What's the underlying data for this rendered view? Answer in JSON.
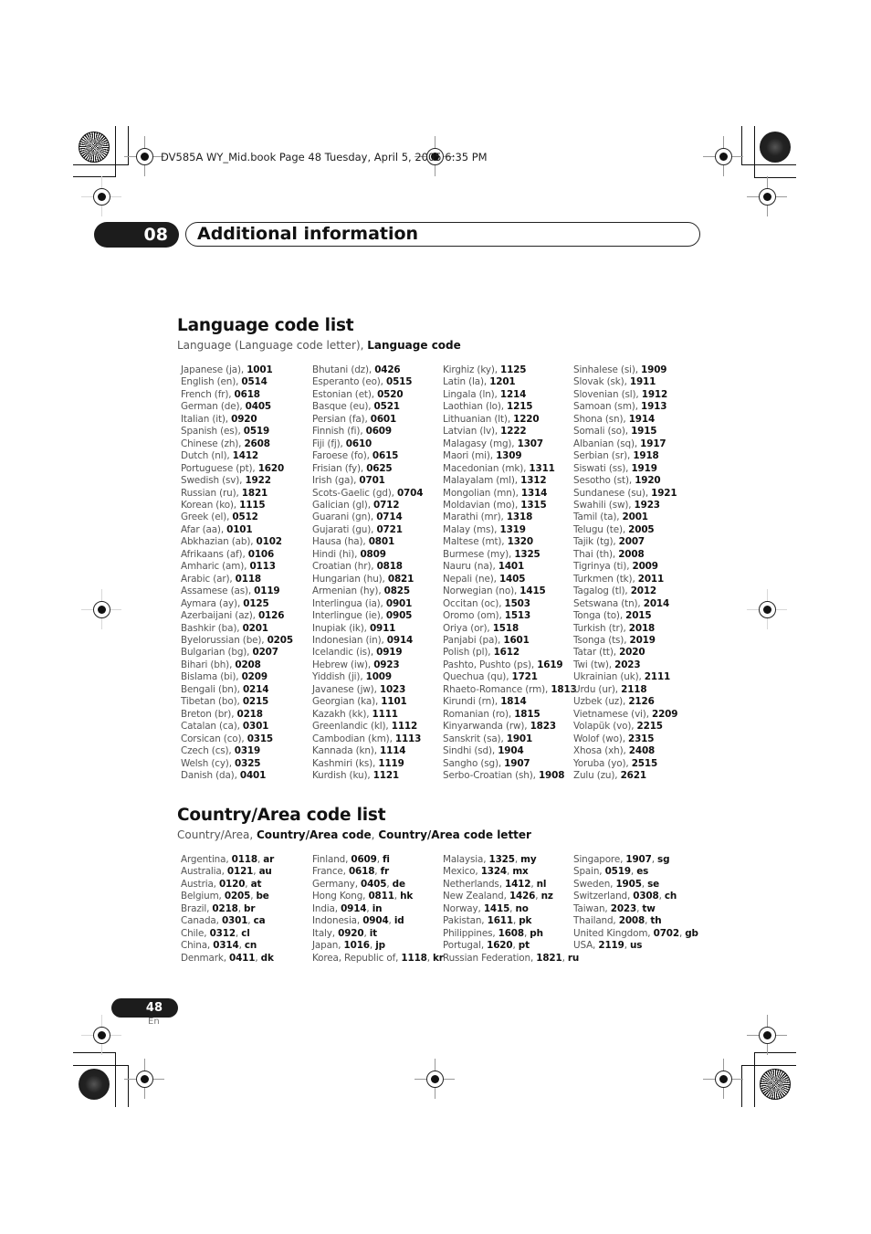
{
  "print_header": {
    "book_line": "DV585A WY_Mid.book  Page 48  Tuesday, April 5, 2005  6:35 PM"
  },
  "chapter": {
    "number": "08",
    "title": "Additional information"
  },
  "language_section": {
    "title": "Language code list",
    "subtitle_plain": "Language (Language code letter), ",
    "subtitle_bold": "Language code",
    "columns": [
      [
        {
          "name": "Japanese (ja), ",
          "code": "1001"
        },
        {
          "name": "English (en), ",
          "code": "0514"
        },
        {
          "name": "French (fr), ",
          "code": "0618"
        },
        {
          "name": "German (de), ",
          "code": "0405"
        },
        {
          "name": "Italian (it), ",
          "code": "0920"
        },
        {
          "name": "Spanish (es), ",
          "code": "0519"
        },
        {
          "name": "Chinese (zh), ",
          "code": "2608"
        },
        {
          "name": "Dutch (nl), ",
          "code": "1412"
        },
        {
          "name": "Portuguese (pt), ",
          "code": "1620"
        },
        {
          "name": "Swedish (sv), ",
          "code": "1922"
        },
        {
          "name": "Russian (ru), ",
          "code": "1821"
        },
        {
          "name": "Korean (ko), ",
          "code": "1115"
        },
        {
          "name": "Greek (el), ",
          "code": "0512"
        },
        {
          "name": "Afar (aa), ",
          "code": "0101"
        },
        {
          "name": "Abkhazian (ab), ",
          "code": "0102"
        },
        {
          "name": "Afrikaans (af), ",
          "code": "0106"
        },
        {
          "name": "Amharic (am), ",
          "code": "0113"
        },
        {
          "name": "Arabic (ar), ",
          "code": "0118"
        },
        {
          "name": "Assamese (as), ",
          "code": "0119"
        },
        {
          "name": "Aymara (ay), ",
          "code": "0125"
        },
        {
          "name": "Azerbaijani (az), ",
          "code": "0126"
        },
        {
          "name": "Bashkir (ba), ",
          "code": "0201"
        },
        {
          "name": "Byelorussian (be), ",
          "code": "0205"
        },
        {
          "name": "Bulgarian (bg), ",
          "code": "0207"
        },
        {
          "name": "Bihari (bh), ",
          "code": "0208"
        },
        {
          "name": "Bislama (bi), ",
          "code": "0209"
        },
        {
          "name": "Bengali (bn), ",
          "code": "0214"
        },
        {
          "name": "Tibetan (bo), ",
          "code": "0215"
        },
        {
          "name": "Breton (br), ",
          "code": "0218"
        },
        {
          "name": "Catalan (ca), ",
          "code": "0301"
        },
        {
          "name": "Corsican (co), ",
          "code": "0315"
        },
        {
          "name": "Czech (cs), ",
          "code": "0319"
        },
        {
          "name": "Welsh (cy), ",
          "code": "0325"
        },
        {
          "name": "Danish (da), ",
          "code": "0401"
        }
      ],
      [
        {
          "name": "Bhutani (dz), ",
          "code": "0426"
        },
        {
          "name": "Esperanto (eo), ",
          "code": "0515"
        },
        {
          "name": "Estonian (et), ",
          "code": "0520"
        },
        {
          "name": "Basque (eu), ",
          "code": "0521"
        },
        {
          "name": "Persian (fa), ",
          "code": "0601"
        },
        {
          "name": "Finnish (fi), ",
          "code": "0609"
        },
        {
          "name": "Fiji (fj), ",
          "code": "0610"
        },
        {
          "name": "Faroese (fo), ",
          "code": "0615"
        },
        {
          "name": "Frisian (fy), ",
          "code": "0625"
        },
        {
          "name": "Irish (ga), ",
          "code": "0701"
        },
        {
          "name": "Scots-Gaelic (gd), ",
          "code": "0704"
        },
        {
          "name": "Galician (gl), ",
          "code": "0712"
        },
        {
          "name": "Guarani (gn), ",
          "code": "0714"
        },
        {
          "name": "Gujarati (gu), ",
          "code": "0721"
        },
        {
          "name": "Hausa (ha), ",
          "code": "0801"
        },
        {
          "name": "Hindi (hi), ",
          "code": "0809"
        },
        {
          "name": "Croatian (hr), ",
          "code": "0818"
        },
        {
          "name": "Hungarian (hu), ",
          "code": "0821"
        },
        {
          "name": "Armenian (hy), ",
          "code": "0825"
        },
        {
          "name": "Interlingua (ia), ",
          "code": "0901"
        },
        {
          "name": "Interlingue (ie), ",
          "code": "0905"
        },
        {
          "name": "Inupiak (ik), ",
          "code": "0911"
        },
        {
          "name": "Indonesian (in), ",
          "code": "0914"
        },
        {
          "name": "Icelandic (is), ",
          "code": "0919"
        },
        {
          "name": "Hebrew (iw), ",
          "code": "0923"
        },
        {
          "name": "Yiddish (ji), ",
          "code": "1009"
        },
        {
          "name": "Javanese (jw), ",
          "code": "1023"
        },
        {
          "name": "Georgian (ka), ",
          "code": "1101"
        },
        {
          "name": "Kazakh (kk), ",
          "code": "1111"
        },
        {
          "name": "Greenlandic  (kl), ",
          "code": "1112"
        },
        {
          "name": "Cambodian (km), ",
          "code": "1113"
        },
        {
          "name": "Kannada (kn), ",
          "code": "1114"
        },
        {
          "name": "Kashmiri (ks), ",
          "code": "1119"
        },
        {
          "name": "Kurdish (ku), ",
          "code": "1121"
        }
      ],
      [
        {
          "name": "Kirghiz (ky), ",
          "code": "1125"
        },
        {
          "name": "Latin (la), ",
          "code": "1201"
        },
        {
          "name": "Lingala (ln), ",
          "code": "1214"
        },
        {
          "name": "Laothian (lo), ",
          "code": "1215"
        },
        {
          "name": "Lithuanian (lt), ",
          "code": "1220"
        },
        {
          "name": "Latvian (lv), ",
          "code": "1222"
        },
        {
          "name": "Malagasy (mg), ",
          "code": "1307"
        },
        {
          "name": "Maori (mi), ",
          "code": "1309"
        },
        {
          "name": "Macedonian (mk), ",
          "code": "1311"
        },
        {
          "name": "Malayalam  (ml), ",
          "code": "1312"
        },
        {
          "name": "Mongolian (mn), ",
          "code": "1314"
        },
        {
          "name": "Moldavian (mo), ",
          "code": "1315"
        },
        {
          "name": "Marathi (mr), ",
          "code": "1318"
        },
        {
          "name": "Malay  (ms), ",
          "code": "1319"
        },
        {
          "name": "Maltese (mt), ",
          "code": "1320"
        },
        {
          "name": "Burmese (my), ",
          "code": "1325"
        },
        {
          "name": "Nauru (na), ",
          "code": "1401"
        },
        {
          "name": "Nepali (ne), ",
          "code": "1405"
        },
        {
          "name": "Norwegian (no), ",
          "code": "1415"
        },
        {
          "name": "Occitan (oc), ",
          "code": "1503"
        },
        {
          "name": "Oromo (om), ",
          "code": "1513"
        },
        {
          "name": "Oriya (or), ",
          "code": "1518"
        },
        {
          "name": "Panjabi (pa), ",
          "code": "1601"
        },
        {
          "name": "Polish (pl), ",
          "code": "1612"
        },
        {
          "name": "Pashto, Pushto (ps), ",
          "code": "1619"
        },
        {
          "name": "Quechua (qu), ",
          "code": "1721"
        },
        {
          "name": "Rhaeto-Romance (rm), ",
          "code": "1813"
        },
        {
          "name": "Kirundi (rn), ",
          "code": "1814"
        },
        {
          "name": "Romanian (ro), ",
          "code": "1815"
        },
        {
          "name": "Kinyarwanda (rw), ",
          "code": "1823"
        },
        {
          "name": "Sanskrit (sa), ",
          "code": "1901"
        },
        {
          "name": "Sindhi (sd), ",
          "code": "1904"
        },
        {
          "name": "Sangho (sg), ",
          "code": "1907"
        },
        {
          "name": "Serbo-Croatian (sh), ",
          "code": "1908"
        }
      ],
      [
        {
          "name": "Sinhalese (si), ",
          "code": "1909"
        },
        {
          "name": "Slovak (sk), ",
          "code": "1911"
        },
        {
          "name": "Slovenian (sl), ",
          "code": "1912"
        },
        {
          "name": "Samoan (sm), ",
          "code": "1913"
        },
        {
          "name": "Shona (sn), ",
          "code": "1914"
        },
        {
          "name": "Somali (so), ",
          "code": "1915"
        },
        {
          "name": "Albanian (sq), ",
          "code": "1917"
        },
        {
          "name": "Serbian (sr), ",
          "code": "1918"
        },
        {
          "name": "Siswati (ss), ",
          "code": "1919"
        },
        {
          "name": "Sesotho (st), ",
          "code": "1920"
        },
        {
          "name": "Sundanese (su), ",
          "code": "1921"
        },
        {
          "name": "Swahili (sw), ",
          "code": "1923"
        },
        {
          "name": "Tamil (ta), ",
          "code": "2001"
        },
        {
          "name": "Telugu (te), ",
          "code": "2005"
        },
        {
          "name": "Tajik (tg), ",
          "code": "2007"
        },
        {
          "name": "Thai (th), ",
          "code": "2008"
        },
        {
          "name": "Tigrinya (ti), ",
          "code": "2009"
        },
        {
          "name": "Turkmen (tk), ",
          "code": "2011"
        },
        {
          "name": "Tagalog (tl), ",
          "code": "2012"
        },
        {
          "name": "Setswana (tn), ",
          "code": "2014"
        },
        {
          "name": "Tonga (to), ",
          "code": "2015"
        },
        {
          "name": "Turkish (tr), ",
          "code": "2018"
        },
        {
          "name": "Tsonga (ts), ",
          "code": "2019"
        },
        {
          "name": "Tatar (tt), ",
          "code": "2020"
        },
        {
          "name": "Twi (tw), ",
          "code": "2023"
        },
        {
          "name": "Ukrainian (uk), ",
          "code": "2111"
        },
        {
          "name": "Urdu (ur), ",
          "code": "2118"
        },
        {
          "name": "Uzbek (uz), ",
          "code": "2126"
        },
        {
          "name": "Vietnamese (vi), ",
          "code": "2209"
        },
        {
          "name": "Volapük (vo), ",
          "code": "2215"
        },
        {
          "name": "Wolof (wo), ",
          "code": "2315"
        },
        {
          "name": "Xhosa (xh), ",
          "code": "2408"
        },
        {
          "name": "Yoruba (yo), ",
          "code": "2515"
        },
        {
          "name": "Zulu (zu), ",
          "code": "2621"
        }
      ]
    ]
  },
  "country_section": {
    "title": "Country/Area code list",
    "subtitle_plain": "Country/Area, ",
    "subtitle_bold_1": "Country/Area code",
    "subtitle_sep": ", ",
    "subtitle_bold_2": "Country/Area code letter",
    "columns": [
      [
        {
          "name": "Argentina, ",
          "code": "0118",
          "letter": "ar"
        },
        {
          "name": "Australia, ",
          "code": "0121",
          "letter": "au"
        },
        {
          "name": "Austria, ",
          "code": "0120",
          "letter": "at"
        },
        {
          "name": "Belgium, ",
          "code": "0205",
          "letter": "be"
        },
        {
          "name": "Brazil, ",
          "code": "0218",
          "letter": "br"
        },
        {
          "name": "Canada, ",
          "code": "0301",
          "letter": "ca"
        },
        {
          "name": "Chile, ",
          "code": "0312",
          "letter": "cl"
        },
        {
          "name": "China, ",
          "code": "0314",
          "letter": "cn"
        },
        {
          "name": "Denmark, ",
          "code": "0411",
          "letter": "dk"
        }
      ],
      [
        {
          "name": "Finland, ",
          "code": "0609",
          "letter": "fi"
        },
        {
          "name": "France, ",
          "code": "0618",
          "letter": "fr"
        },
        {
          "name": "Germany, ",
          "code": "0405",
          "letter": "de"
        },
        {
          "name": "Hong Kong, ",
          "code": "0811",
          "letter": "hk"
        },
        {
          "name": "India, ",
          "code": "0914",
          "letter": "in"
        },
        {
          "name": "Indonesia, ",
          "code": "0904",
          "letter": "id"
        },
        {
          "name": "Italy, ",
          "code": "0920",
          "letter": "it"
        },
        {
          "name": "Japan, ",
          "code": "1016",
          "letter": "jp"
        },
        {
          "name": "Korea, Republic of, ",
          "code": "1118",
          "letter": "kr"
        }
      ],
      [
        {
          "name": "Malaysia, ",
          "code": "1325",
          "letter": "my"
        },
        {
          "name": "Mexico, ",
          "code": "1324",
          "letter": "mx"
        },
        {
          "name": "Netherlands, ",
          "code": "1412",
          "letter": "nl"
        },
        {
          "name": "New Zealand, ",
          "code": "1426",
          "letter": "nz"
        },
        {
          "name": "Norway, ",
          "code": "1415",
          "letter": "no"
        },
        {
          "name": "Pakistan, ",
          "code": "1611",
          "letter": "pk"
        },
        {
          "name": "Philippines, ",
          "code": "1608",
          "letter": "ph"
        },
        {
          "name": "Portugal, ",
          "code": "1620",
          "letter": "pt"
        },
        {
          "name": "Russian Federation, ",
          "code": "1821",
          "letter": "ru"
        }
      ],
      [
        {
          "name": "Singapore, ",
          "code": "1907",
          "letter": "sg"
        },
        {
          "name": "Spain, ",
          "code": "0519",
          "letter": "es"
        },
        {
          "name": "Sweden, ",
          "code": "1905",
          "letter": "se"
        },
        {
          "name": "Switzerland, ",
          "code": "0308",
          "letter": "ch"
        },
        {
          "name": "Taiwan, ",
          "code": "2023",
          "letter": "tw"
        },
        {
          "name": "Thailand, ",
          "code": "2008",
          "letter": "th"
        },
        {
          "name": "United Kingdom, ",
          "code": "0702",
          "letter": "gb"
        },
        {
          "name": "USA, ",
          "code": "2119",
          "letter": "us"
        }
      ]
    ]
  },
  "footer": {
    "page_number": "48",
    "language": "En"
  }
}
